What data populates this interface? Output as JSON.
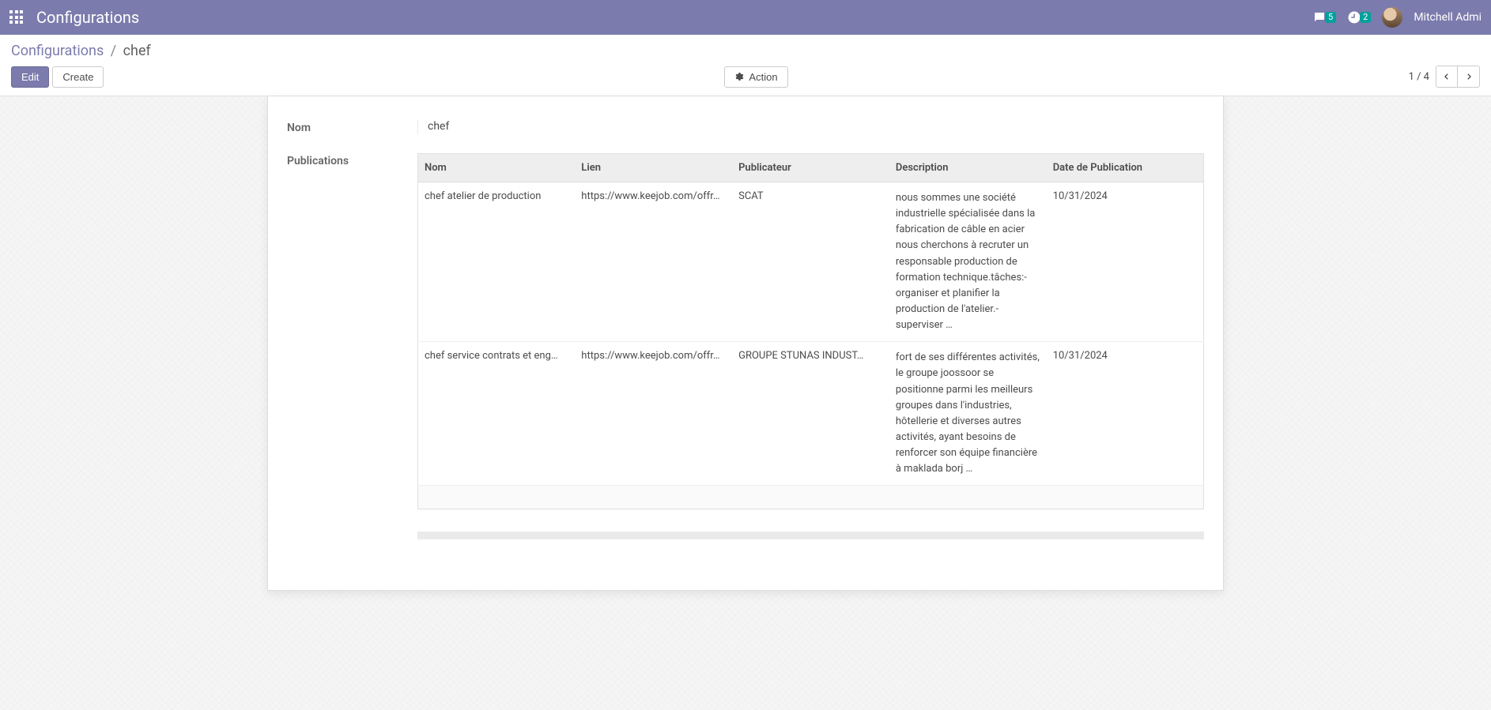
{
  "topbar": {
    "title": "Configurations",
    "chat_badge": "5",
    "activity_badge": "2",
    "username": "Mitchell Admi"
  },
  "breadcrumb": {
    "parent": "Configurations",
    "current": "chef"
  },
  "toolbar": {
    "edit_label": "Edit",
    "create_label": "Create",
    "action_label": "Action",
    "pager_text": "1 / 4"
  },
  "form": {
    "name_label": "Nom",
    "name_value": "chef",
    "publications_label": "Publications",
    "table": {
      "headers": {
        "nom": "Nom",
        "lien": "Lien",
        "publicateur": "Publicateur",
        "description": "Description",
        "date": "Date de Publication"
      },
      "rows": [
        {
          "nom": "chef atelier de production",
          "lien": "https://www.keejob.com/offr…",
          "publicateur": "SCAT",
          "description": "nous sommes une société industrielle spécialisée dans la fabrication de câble en acier nous cherchons à recruter un responsable production de formation technique.tâches:-  organiser et planifier la production de l'atelier.-  superviser …",
          "date": "10/31/2024"
        },
        {
          "nom": "chef service contrats et eng…",
          "lien": "https://www.keejob.com/offr…",
          "publicateur": "GROUPE STUNAS INDUST…",
          "description": "fort de ses différentes activités, le groupe joossoor se positionne parmi les meilleurs groupes dans l'industries, hôtellerie et diverses autres activités, ayant besoins de renforcer son équipe financière à maklada borj …",
          "date": "10/31/2024"
        }
      ]
    }
  }
}
